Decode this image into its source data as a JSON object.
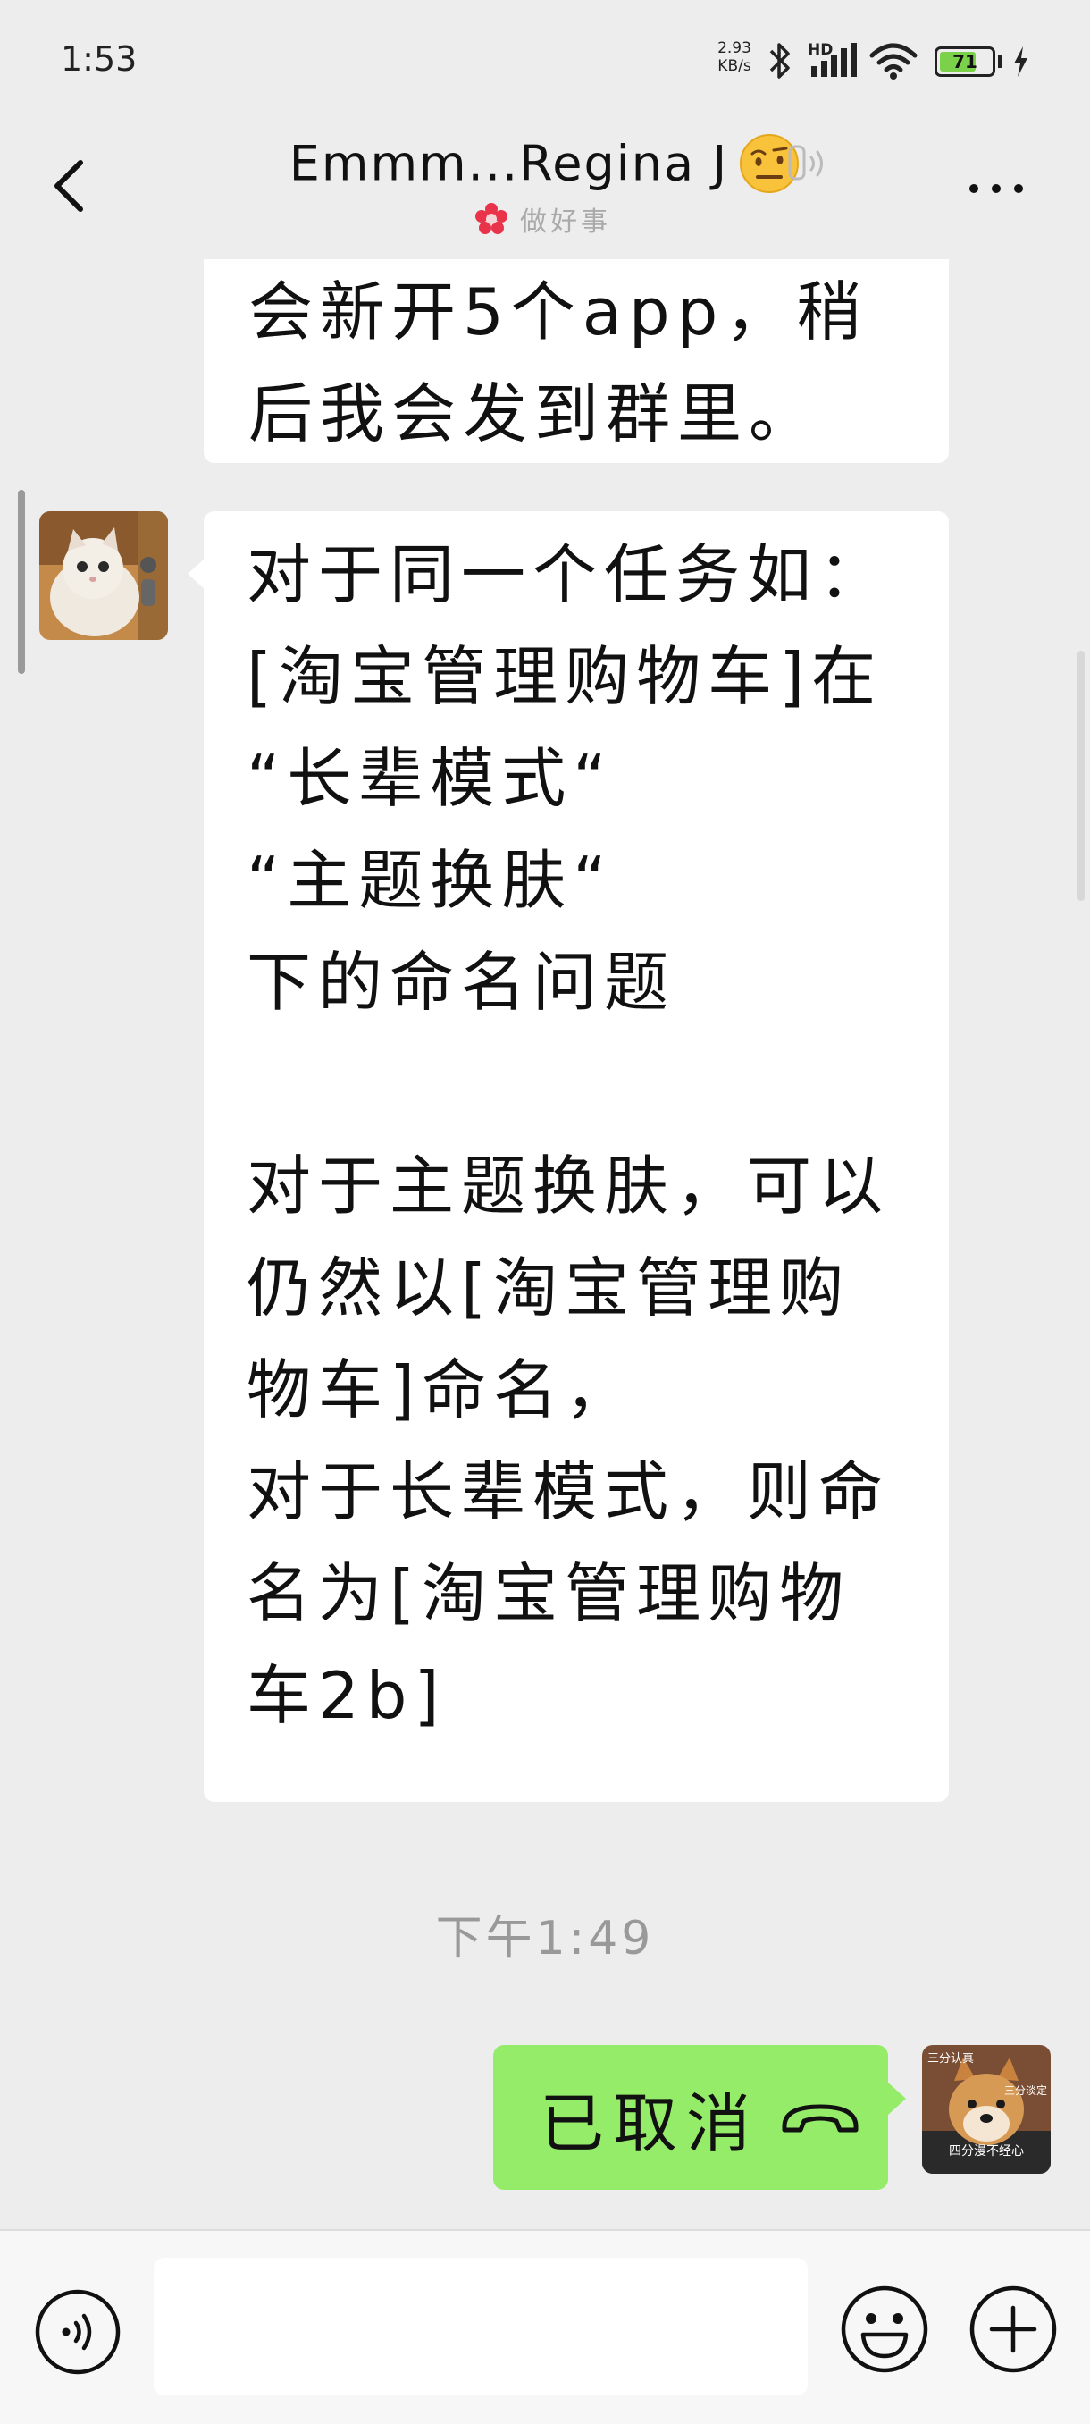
{
  "status_bar": {
    "time": "1:53",
    "net_speed_value": "2.93",
    "net_speed_unit": "KB/s",
    "network_type": "HD",
    "battery_level": "71",
    "battery_fraction": 0.71,
    "icons": [
      "bluetooth-icon",
      "signal-icon",
      "wifi-icon",
      "battery-icon",
      "charging-icon"
    ]
  },
  "header": {
    "back_icon": "chevron-left-icon",
    "title": "Emmm...Regina J",
    "title_emoji": "raised-eyebrow-emoji",
    "earpiece_icon": "earpiece-mode-icon",
    "subtitle": "做好事",
    "subtitle_icon": "red-flower-icon",
    "more_icon": "more-dots-icon"
  },
  "messages": [
    {
      "sender": "other",
      "text": "会新开5个app，稍\n后我会发到群里。"
    },
    {
      "sender": "other",
      "avatar": "cat-avatar",
      "text": "对于同一个任务如：\n[淘宝管理购物车]在\n“长辈模式“\n“主题换肤“\n下的命名问题\n\n对于主题换肤，可以\n仍然以[淘宝管理购\n物车]命名，\n对于长辈模式，则命\n名为[淘宝管理购物\n车2b]"
    },
    {
      "type": "timestamp",
      "text": "下午1:49"
    },
    {
      "sender": "me",
      "avatar": "shiba-dog-avatar",
      "text": "已取消",
      "icon": "hang-up-phone-icon"
    }
  ],
  "my_avatar_overlay": {
    "top_left": "三分认真",
    "top_right": "三分淡定",
    "bottom": "四分漫不经心"
  },
  "input_bar": {
    "voice_icon": "voice-input-icon",
    "input_value": "",
    "emoji_icon": "emoji-smile-icon",
    "plus_icon": "plus-circle-icon"
  },
  "colors": {
    "background": "#ededed",
    "bubble_other": "#ffffff",
    "bubble_me": "#95ec69",
    "battery_fill": "#7cd14a",
    "flower": "#e8334a"
  }
}
